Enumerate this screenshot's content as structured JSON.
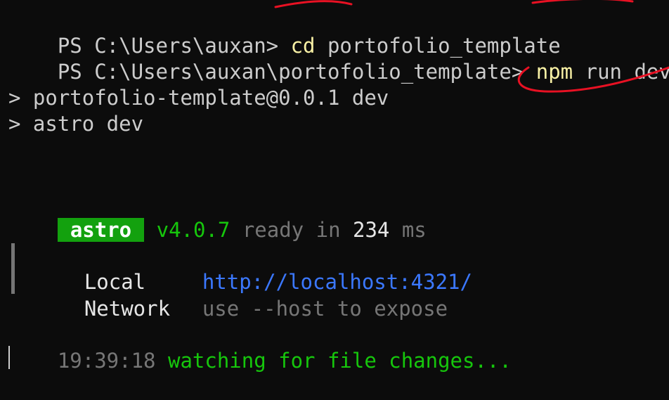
{
  "prompt": {
    "line1_prefix": "PS C:\\Users\\auxan> ",
    "line1_cmd": "cd",
    "line1_arg": " portofolio_template",
    "line2_prefix": "PS C:\\Users\\auxan\\portofolio_template> ",
    "line2_cmd": "npm",
    "line2_arg": " run dev"
  },
  "script": {
    "line1": "> portofolio-template@0.0.1 dev",
    "line2": "> astro dev"
  },
  "astro": {
    "badge": "astro",
    "version": "v4.0.7",
    "ready_text": " ready in ",
    "time_value": "234",
    "time_unit": " ms"
  },
  "server": {
    "local_label": "Local",
    "local_url": "http://localhost:4321/",
    "network_label": "Network",
    "network_value": "use --host to expose"
  },
  "watch": {
    "timestamp": "19:39:18",
    "message": " watching for file changes..."
  },
  "colors": {
    "background": "#0c0c0c",
    "foreground": "#cccccc",
    "yellow": "#f9f1a5",
    "green": "#16c60c",
    "badge_green": "#13a10e",
    "blue": "#3b78ff",
    "gray": "#767676",
    "annotation_red": "#e81123"
  }
}
